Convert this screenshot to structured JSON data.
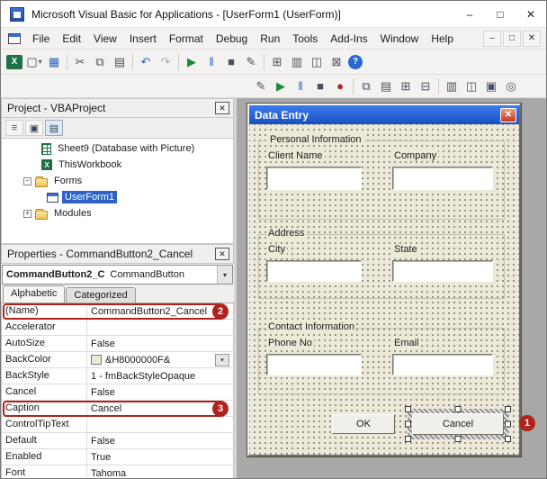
{
  "titlebar": {
    "title": "Microsoft Visual Basic for Applications - [UserForm1 (UserForm)]",
    "minimize": "–",
    "maximize": "□",
    "close": "✕"
  },
  "menubar": {
    "items": [
      "File",
      "Edit",
      "View",
      "Insert",
      "Format",
      "Debug",
      "Run",
      "Tools",
      "Add-Ins",
      "Window",
      "Help"
    ],
    "child_minimize": "–",
    "child_restore": "□",
    "child_close": "✕"
  },
  "toolbar_main": {
    "icons": [
      {
        "name": "excel-icon",
        "glyph": "X"
      },
      {
        "name": "insert-userform-icon",
        "glyph": "▢"
      },
      {
        "name": "insert-userform-dropdown-icon",
        "glyph": "▾"
      },
      {
        "name": "save-icon",
        "glyph": "▦"
      },
      {
        "name": "cut-icon",
        "glyph": "✂"
      },
      {
        "name": "copy-icon",
        "glyph": "⧉"
      },
      {
        "name": "paste-icon",
        "glyph": "▤"
      },
      {
        "name": "undo-icon",
        "glyph": "↶"
      },
      {
        "name": "redo-icon",
        "glyph": "↷"
      },
      {
        "name": "run-icon",
        "glyph": "▶"
      },
      {
        "name": "break-icon",
        "glyph": "‖"
      },
      {
        "name": "reset-icon",
        "glyph": "■"
      },
      {
        "name": "design-mode-icon",
        "glyph": "✎"
      },
      {
        "name": "project-explorer-icon",
        "glyph": "⊞"
      },
      {
        "name": "properties-window-icon",
        "glyph": "▥"
      },
      {
        "name": "object-browser-icon",
        "glyph": "◫"
      },
      {
        "name": "toolbox-icon",
        "glyph": "⊠"
      },
      {
        "name": "help-icon",
        "glyph": "?"
      }
    ]
  },
  "toolbar_form": {
    "icons": [
      {
        "name": "design-mode2-icon",
        "glyph": "✎"
      },
      {
        "name": "run2-icon",
        "glyph": "▶"
      },
      {
        "name": "break2-icon",
        "glyph": "‖"
      },
      {
        "name": "reset2-icon",
        "glyph": "■"
      },
      {
        "name": "breakpoint-icon",
        "glyph": "●"
      },
      {
        "name": "bring-to-front-icon",
        "glyph": "⧉"
      },
      {
        "name": "send-to-back-icon",
        "glyph": "▤"
      },
      {
        "name": "group-icon",
        "glyph": "⊞"
      },
      {
        "name": "ungroup-icon",
        "glyph": "⊟"
      },
      {
        "name": "align-icon",
        "glyph": "▥"
      },
      {
        "name": "center-icon",
        "glyph": "◫"
      },
      {
        "name": "same-size-icon",
        "glyph": "▣"
      },
      {
        "name": "zoom-icon",
        "glyph": "◎"
      }
    ]
  },
  "project_panel": {
    "title": "Project - VBAProject",
    "close": "✕",
    "buttons": [
      {
        "name": "view-code-icon",
        "glyph": "≡"
      },
      {
        "name": "view-object-icon",
        "glyph": "▣"
      },
      {
        "name": "toggle-folders-icon",
        "glyph": "▤"
      }
    ],
    "tree": {
      "sheet9": "Sheet9 (Database with Picture)",
      "thisworkbook": "ThisWorkbook",
      "forms": "Forms",
      "forms_expander": "−",
      "userform1": "UserForm1",
      "modules": "Modules",
      "modules_expander": "+"
    }
  },
  "properties_panel": {
    "title": "Properties - CommandButton2_Cancel",
    "close": "✕",
    "selector_name": "CommandButton2_C",
    "selector_type": "CommandButton",
    "tabs": [
      "Alphabetic",
      "Categorized"
    ],
    "rows": [
      {
        "name": "(Name)",
        "value": "CommandButton2_Cancel"
      },
      {
        "name": "Accelerator",
        "value": ""
      },
      {
        "name": "AutoSize",
        "value": "False"
      },
      {
        "name": "BackColor",
        "value": "&H8000000F&"
      },
      {
        "name": "BackStyle",
        "value": "1 - fmBackStyleOpaque"
      },
      {
        "name": "Cancel",
        "value": "False"
      },
      {
        "name": "Caption",
        "value": "Cancel"
      },
      {
        "name": "ControlTipText",
        "value": ""
      },
      {
        "name": "Default",
        "value": "False"
      },
      {
        "name": "Enabled",
        "value": "True"
      },
      {
        "name": "Font",
        "value": "Tahoma"
      }
    ]
  },
  "designer": {
    "title": "Data Entry",
    "close": "✕",
    "frames": [
      {
        "caption": "Personal Information",
        "fields": [
          {
            "label": "Client Name"
          },
          {
            "label": "Company"
          }
        ]
      },
      {
        "caption": "Address",
        "fields": [
          {
            "label": "City"
          },
          {
            "label": "State"
          }
        ]
      },
      {
        "caption": "Contact Information",
        "fields": [
          {
            "label": "Phone No"
          },
          {
            "label": "Email"
          }
        ]
      }
    ],
    "ok_label": "OK",
    "cancel_label": "Cancel"
  },
  "markers": {
    "m1": "1",
    "m2": "2",
    "m3": "3"
  },
  "colors": {
    "marker_red": "#b0231c",
    "selection_blue": "#2d63c8",
    "form_bg": "#ece9d8",
    "mdi_gray": "#a8a8a8",
    "designer_title_blue": "#1a50c0"
  }
}
